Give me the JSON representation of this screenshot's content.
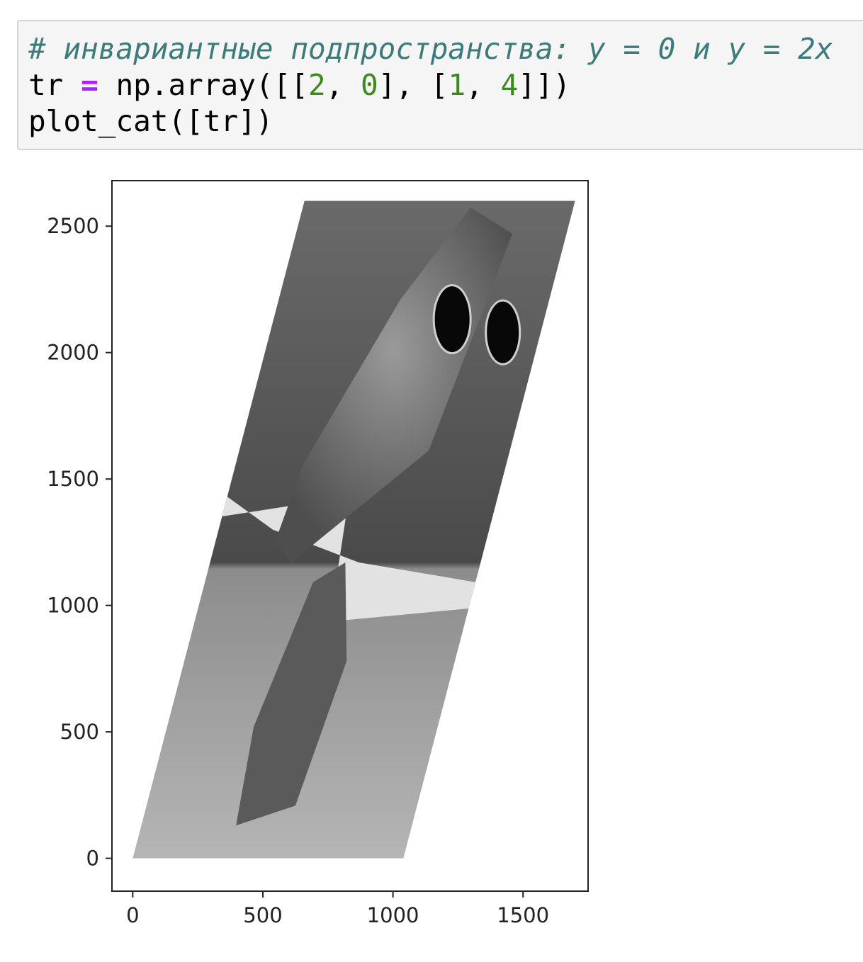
{
  "code_cell": {
    "comment": "# инвариантные подпространства: y = 0 и y = 2x",
    "line2": {
      "var": "tr",
      "op": "=",
      "call": "np.array([[",
      "n1": "2",
      "sep1": ", ",
      "n2": "0",
      "mid": "], [",
      "n3": "1",
      "sep2": ", ",
      "n4": "4",
      "end": "]])"
    },
    "line3": "plot_cat([tr])"
  },
  "chart_data": {
    "type": "image",
    "title": "",
    "xlabel": "",
    "ylabel": "",
    "xlim": [
      -80,
      1750
    ],
    "ylim": [
      -130,
      2680
    ],
    "x_ticks": [
      "0",
      "500",
      "1000",
      "1500"
    ],
    "x_tick_values": [
      0,
      500,
      1000,
      1500
    ],
    "y_ticks": [
      "0",
      "500",
      "1000",
      "1500",
      "2000",
      "2500"
    ],
    "y_tick_values": [
      0,
      500,
      1000,
      1500,
      2000,
      2500
    ],
    "image_corners": [
      [
        0,
        0
      ],
      [
        1040,
        0
      ],
      [
        1700,
        2600
      ],
      [
        660,
        2600
      ]
    ],
    "image_content": "grayscale cat wearing sunglasses, sheared by matrix [[2, 0], [1, 4]]",
    "colors": {
      "background_dark": "#555555",
      "frame": "#222222"
    }
  }
}
